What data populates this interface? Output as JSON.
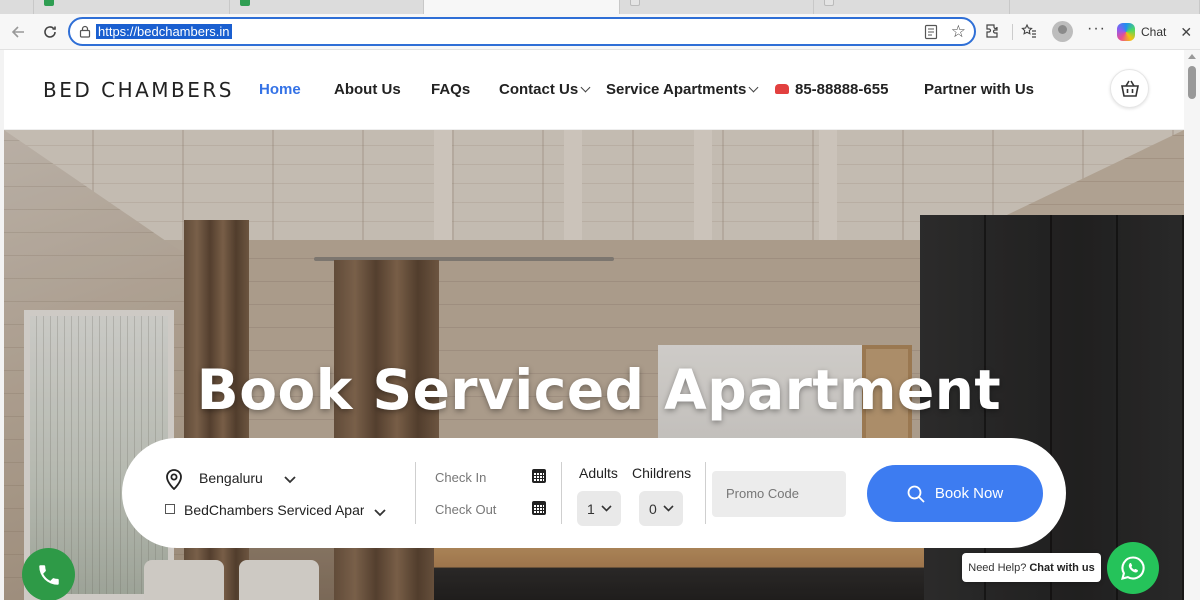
{
  "browser": {
    "url": "https://bedchambers.in",
    "chat_label": "Chat"
  },
  "header": {
    "logo": "BED CHAMBERS",
    "nav": {
      "home": "Home",
      "about": "About Us",
      "faqs": "FAQs",
      "contact": "Contact Us",
      "service_apartments": "Service Apartments",
      "phone": "85-88888-655",
      "partner": "Partner with Us"
    }
  },
  "hero": {
    "title": "Book Serviced Apartment"
  },
  "booking": {
    "city": "Bengaluru",
    "property": "BedChambers Serviced Apart",
    "check_in_placeholder": "Check In",
    "check_out_placeholder": "Check Out",
    "adults_label": "Adults",
    "children_label": "Childrens",
    "adults_value": "1",
    "children_value": "0",
    "promo_placeholder": "Promo Code",
    "book_label": "Book Now"
  },
  "widgets": {
    "help_text": "Need Help?",
    "help_link": "Chat with us"
  },
  "colors": {
    "accent": "#3d7cf1",
    "nav_active": "#3472e6",
    "whatsapp": "#25c35a",
    "call": "#2e9a47"
  }
}
